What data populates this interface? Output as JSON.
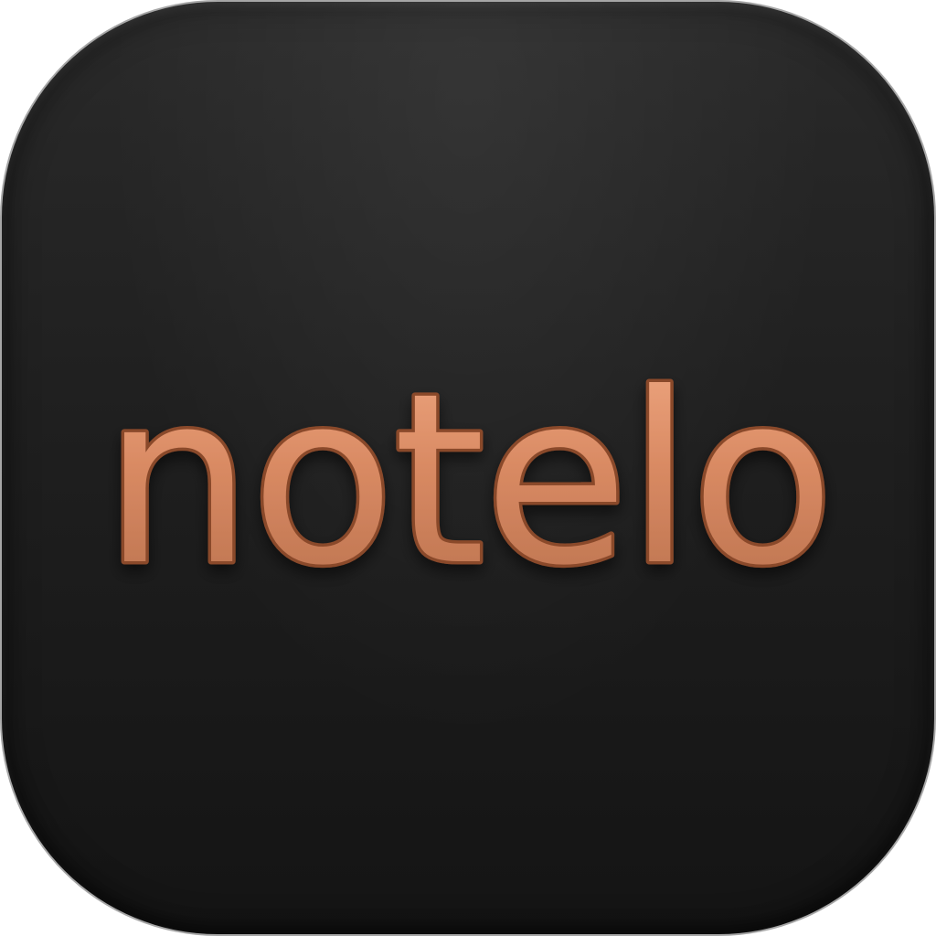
{
  "logo": {
    "wordmark": "notelo",
    "colors": {
      "background_top": "#2a2a2a",
      "background_bottom": "#141414",
      "text_fill": "#d98a63",
      "text_outline": "#8a4a2c",
      "text_highlight": "#f0a882"
    }
  }
}
